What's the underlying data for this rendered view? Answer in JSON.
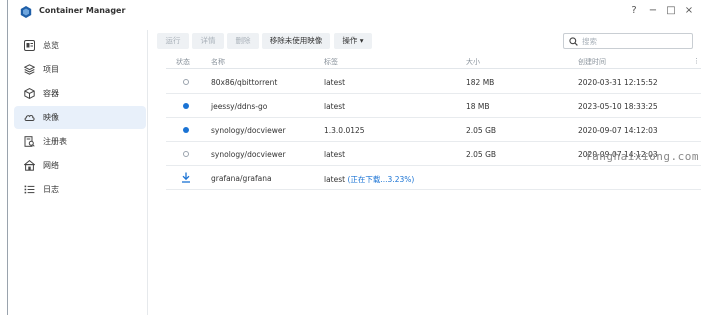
{
  "app": {
    "title": "Container Manager"
  },
  "window_controls": {
    "help": "?",
    "minimize": "−",
    "maximize": "□",
    "close": "×"
  },
  "sidebar": {
    "items": [
      {
        "label": "总览",
        "icon": "overview-icon"
      },
      {
        "label": "项目",
        "icon": "project-icon"
      },
      {
        "label": "容器",
        "icon": "container-icon"
      },
      {
        "label": "映像",
        "icon": "image-icon",
        "active": true
      },
      {
        "label": "注册表",
        "icon": "registry-icon"
      },
      {
        "label": "网络",
        "icon": "network-icon"
      },
      {
        "label": "日志",
        "icon": "log-icon"
      }
    ]
  },
  "toolbar": {
    "run": "运行",
    "details": "详情",
    "delete": "删除",
    "remove_unused": "移除未使用映像",
    "actions": "操作 ▾"
  },
  "search": {
    "placeholder": "搜索"
  },
  "table": {
    "headers": {
      "status": "状态",
      "name": "名称",
      "tag": "标签",
      "size": "大小",
      "created": "创建时间",
      "menu": "⋮"
    },
    "rows": [
      {
        "status": "stopped",
        "name": "80x86/qbittorrent",
        "tag": "latest",
        "size": "182 MB",
        "created": "2020-03-31 12:15:52"
      },
      {
        "status": "running",
        "name": "jeessy/ddns-go",
        "tag": "latest",
        "size": "18 MB",
        "created": "2023-05-10 18:33:25"
      },
      {
        "status": "running",
        "name": "synology/docviewer",
        "tag": "1.3.0.0125",
        "size": "2.05 GB",
        "created": "2020-09-07 14:12:03"
      },
      {
        "status": "stopped",
        "name": "synology/docviewer",
        "tag": "latest",
        "size": "2.05 GB",
        "created": "2020-09-07 14:12:03"
      },
      {
        "status": "downloading",
        "name": "grafana/grafana",
        "tag": "latest",
        "progress": "(正在下载...3.23%)",
        "size": "",
        "created": ""
      }
    ]
  },
  "watermark": "fanghaixiong.com",
  "colors": {
    "accent": "#1a73d4",
    "active_nav_bg": "#e8f0fa"
  }
}
